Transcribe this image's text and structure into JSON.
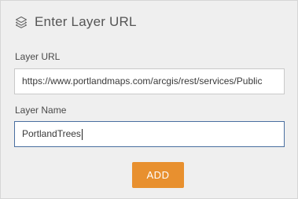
{
  "header": {
    "icon": "layers-icon",
    "title": "Enter Layer URL"
  },
  "layer_url": {
    "label": "Layer URL",
    "value": "https://www.portlandmaps.com/arcgis/rest/services/Public"
  },
  "layer_name": {
    "label": "Layer Name",
    "value": "PortlandTrees"
  },
  "add_button": {
    "label": "ADD",
    "color": "#e8902f"
  }
}
